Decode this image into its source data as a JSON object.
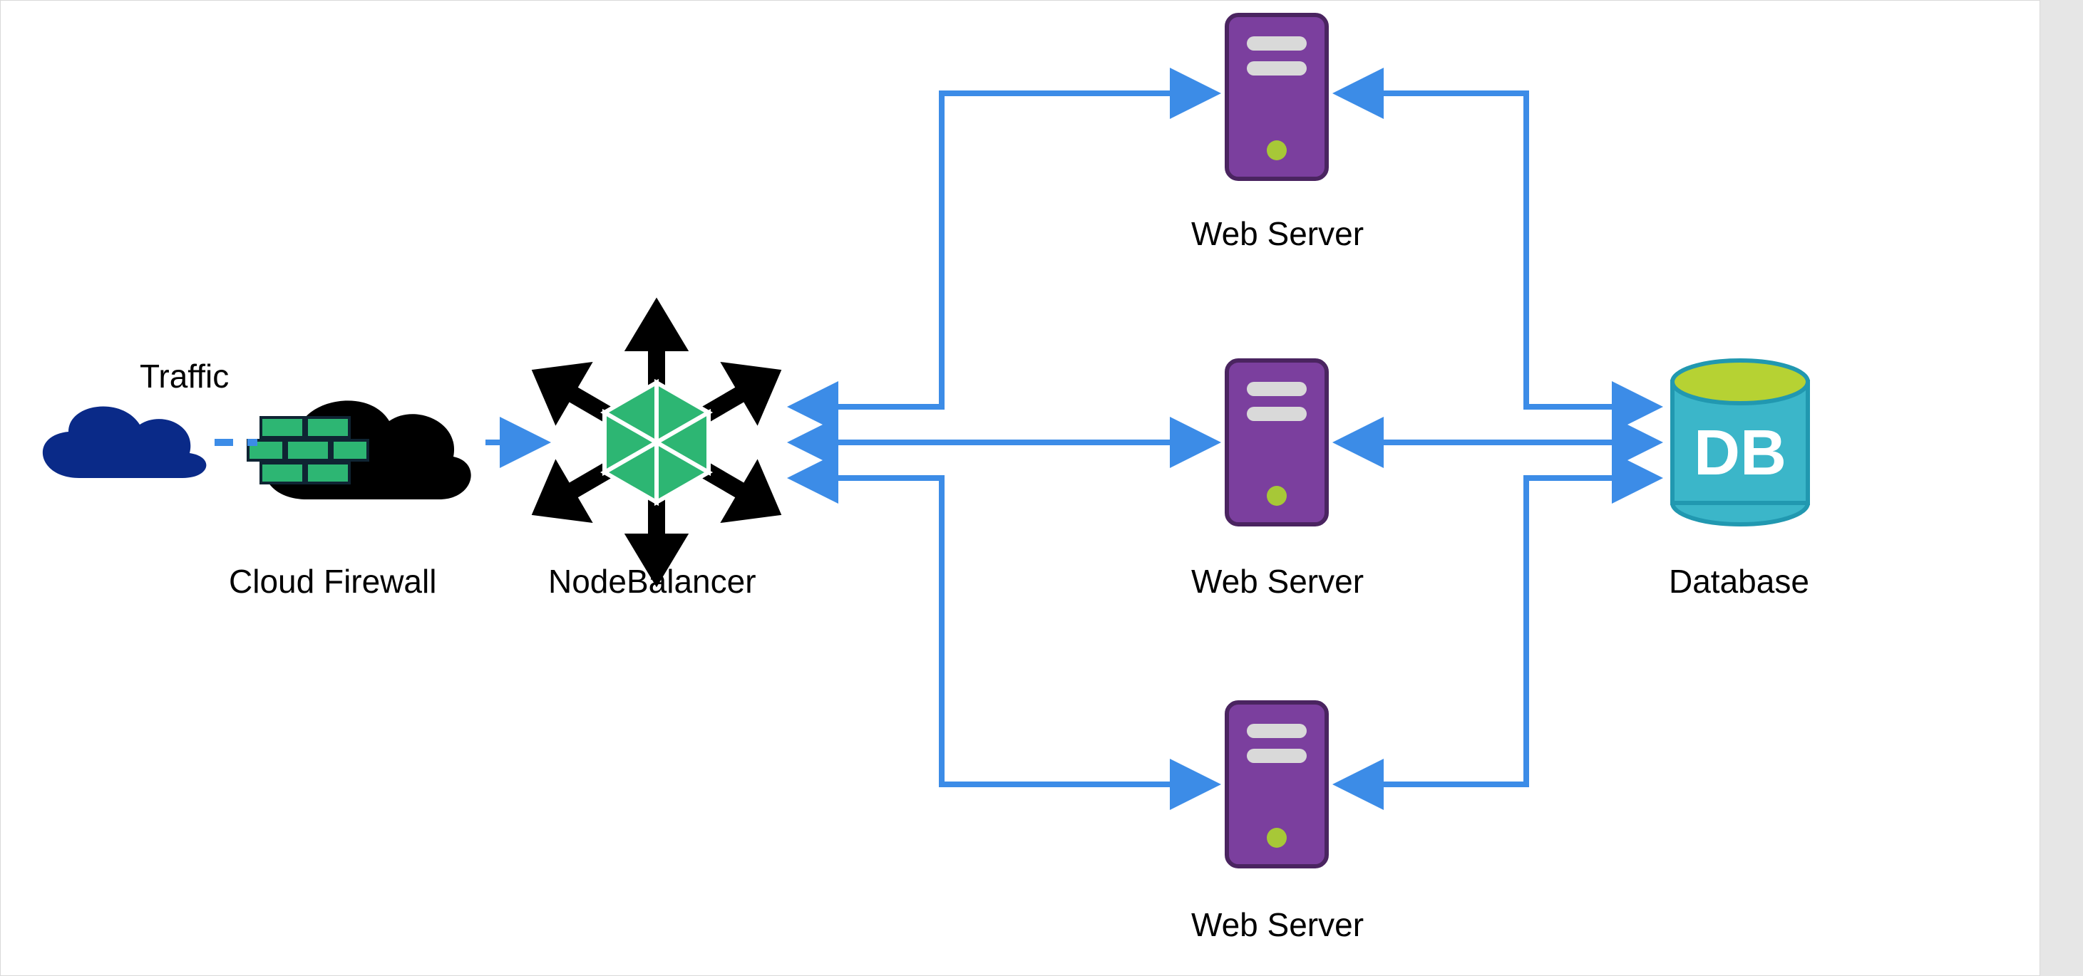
{
  "labels": {
    "traffic": "Traffic",
    "cloud_firewall": "Cloud Firewall",
    "node_balancer": "NodeBalancer",
    "web_server_top": "Web Server",
    "web_server_mid": "Web Server",
    "web_server_bot": "Web Server",
    "database": "Database",
    "db_text": "DB"
  },
  "colors": {
    "arrow": "#3C8CE7",
    "traffic_cloud": "#0A2A88",
    "firewall_cloud": "#000000",
    "firewall_brick": "#2DB673",
    "firewall_brick_stroke": "#0F2433",
    "nb_black": "#000000",
    "nb_green": "#2DB673",
    "server_body": "#7B3F9E",
    "server_stroke": "#4A2460",
    "server_slot": "#D9D9D9",
    "server_led": "#A7C837",
    "db_body": "#3BB6C9",
    "db_stroke": "#2198B0",
    "db_top": "#B6D233",
    "db_text": "#FFFFFF"
  }
}
